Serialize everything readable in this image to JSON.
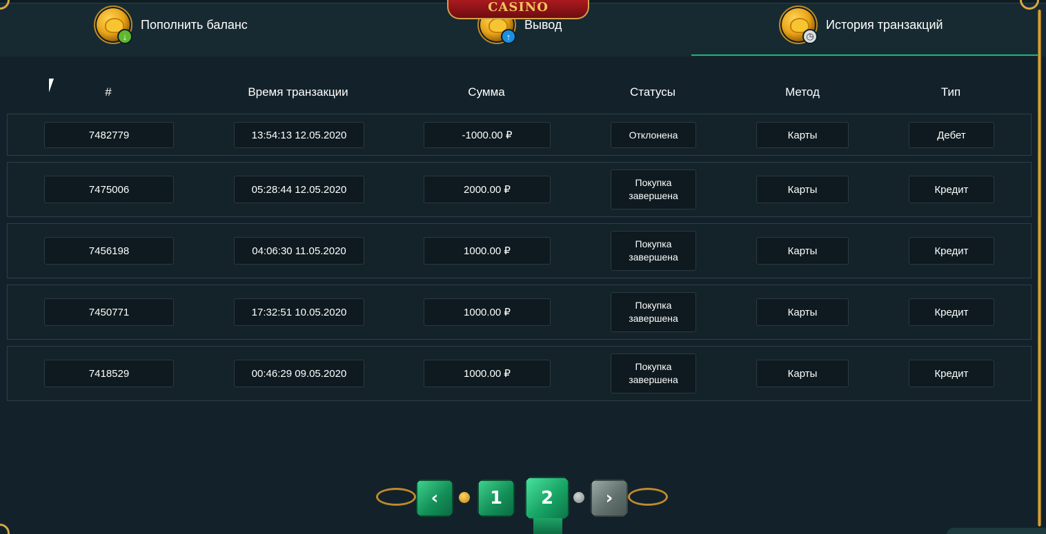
{
  "logo": {
    "text": "CASINO"
  },
  "tabs": [
    {
      "label": "Пополнить баланс",
      "badge": "↓"
    },
    {
      "label": "Вывод",
      "badge": "↑"
    },
    {
      "label": "История транзакций",
      "badge": "◷"
    }
  ],
  "active_tab": "История транзакций",
  "table": {
    "headers": [
      "#",
      "Время транзакции",
      "Сумма",
      "Статусы",
      "Метод",
      "Тип"
    ],
    "rows": [
      {
        "id": "7482779",
        "time": "13:54:13 12.05.2020",
        "amount": "-1000.00 ₽",
        "status": "Отклонена",
        "method": "Карты",
        "type": "Дебет"
      },
      {
        "id": "7475006",
        "time": "05:28:44 12.05.2020",
        "amount": "2000.00 ₽",
        "status": "Покупка завершена",
        "method": "Карты",
        "type": "Кредит"
      },
      {
        "id": "7456198",
        "time": "04:06:30 11.05.2020",
        "amount": "1000.00 ₽",
        "status": "Покупка завершена",
        "method": "Карты",
        "type": "Кредит"
      },
      {
        "id": "7450771",
        "time": "17:32:51 10.05.2020",
        "amount": "1000.00 ₽",
        "status": "Покупка завершена",
        "method": "Карты",
        "type": "Кредит"
      },
      {
        "id": "7418529",
        "time": "00:46:29 09.05.2020",
        "amount": "1000.00 ₽",
        "status": "Покупка завершена",
        "method": "Карты",
        "type": "Кредит"
      }
    ]
  },
  "pagination": {
    "prev": "‹",
    "pages": [
      "1",
      "2"
    ],
    "current": "2",
    "next": "›"
  },
  "colors": {
    "background": "#13222a",
    "accent": "#1fb67a",
    "gold": "#d9a844"
  },
  "icons": [
    "coin-deposit-icon",
    "coin-withdraw-icon",
    "coin-history-icon",
    "chevron-left-icon",
    "chevron-right-icon",
    "mouse-cursor-icon"
  ]
}
